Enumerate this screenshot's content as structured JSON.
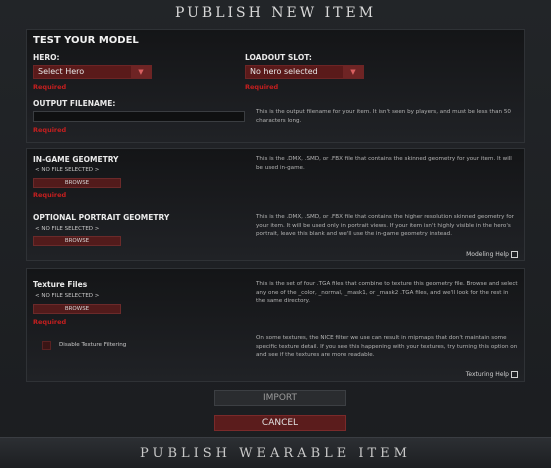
{
  "window": {
    "title": "PUBLISH NEW ITEM"
  },
  "test_model": {
    "heading": "TEST YOUR MODEL",
    "hero": {
      "label": "HERO:",
      "selected": "Select Hero",
      "required": "Required"
    },
    "loadout": {
      "label": "LOADOUT SLOT:",
      "selected": "No hero selected",
      "required": "Required"
    },
    "output": {
      "label": "OUTPUT FILENAME:",
      "value": "",
      "required": "Required",
      "description": "This is the output filename for your item. It isn't seen by players, and must be less than 50 characters long."
    }
  },
  "geometry": {
    "ingame": {
      "label": "IN-GAME GEOMETRY",
      "file_status": "< NO FILE SELECTED >",
      "browse_label": "BROWSE",
      "required": "Required",
      "description": "This is the .DMX, .SMD, or .FBX file that contains the skinned geometry for your item. It will be used in-game."
    },
    "portrait": {
      "label": "OPTIONAL PORTRAIT GEOMETRY",
      "file_status": "< NO FILE SELECTED >",
      "browse_label": "BROWSE",
      "description": "This is the .DMX, .SMD, or .FBX file that contains the higher resolution skinned geometry for your item. It will be used only in portrait views. If your item isn't highly visible in the hero's portrait, leave this blank and we'll use the in-game geometry instead."
    },
    "help_label": "Modeling Help"
  },
  "textures": {
    "label": "Texture Files",
    "file_status": "< NO FILE SELECTED >",
    "browse_label": "BROWSE",
    "required": "Required",
    "description": "This is the set of four .TGA files that combine to texture this geometry file. Browse and select any one of the _color, _normal, _mask1, or _mask2 .TGA files, and we'll look for the rest in the same directory.",
    "filter_label": "Disable Texture Filtering",
    "filter_checked": false,
    "filter_description": "On some textures, the NICE filter we use can result in mipmaps that don't maintain some specific texture detail. If you see this happening with your textures, try turning this option on and see if the textures are more readable.",
    "help_label": "Texturing Help"
  },
  "actions": {
    "import_label": "IMPORT",
    "cancel_label": "CANCEL"
  },
  "footer": {
    "label": "PUBLISH WEARABLE ITEM"
  },
  "colors": {
    "accent": "#5b1c1c",
    "required": "#c61f1f"
  }
}
